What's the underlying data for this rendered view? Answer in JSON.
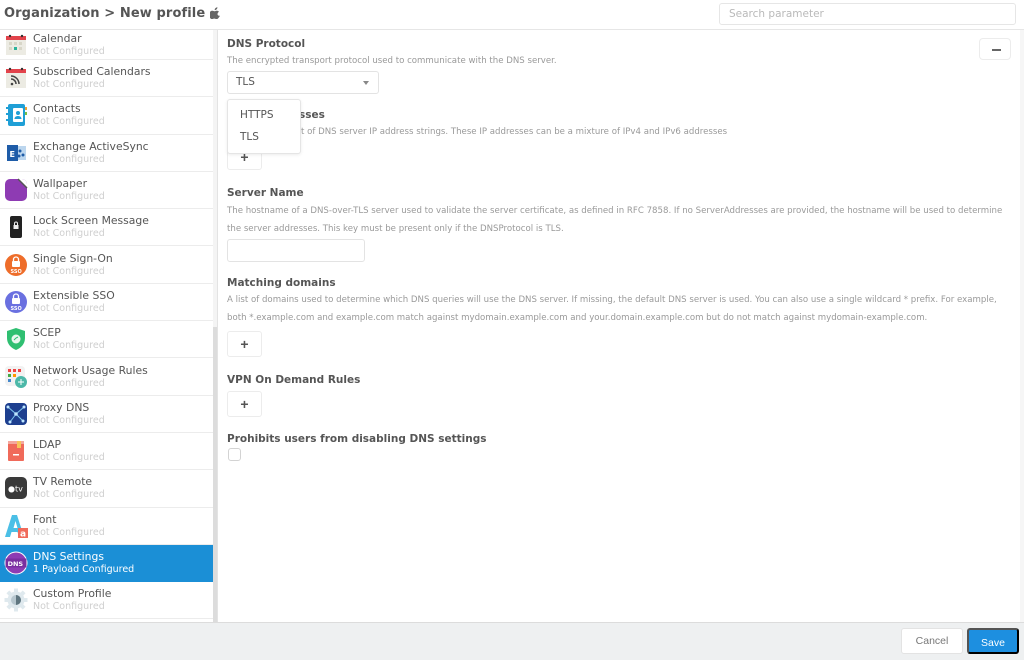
{
  "header": {
    "breadcrumb": "Organization > New profile",
    "platform_icon": "apple-icon",
    "search_placeholder": "Search parameter"
  },
  "sidebar": {
    "items": [
      {
        "label": "Calendar",
        "status": "Not Configured",
        "icon": "calendar-icon"
      },
      {
        "label": "Subscribed Calendars",
        "status": "Not Configured",
        "icon": "subscribed-calendar-icon"
      },
      {
        "label": "Contacts",
        "status": "Not Configured",
        "icon": "contacts-icon"
      },
      {
        "label": "Exchange ActiveSync",
        "status": "Not Configured",
        "icon": "exchange-icon"
      },
      {
        "label": "Wallpaper",
        "status": "Not Configured",
        "icon": "wallpaper-icon"
      },
      {
        "label": "Lock Screen Message",
        "status": "Not Configured",
        "icon": "lock-screen-icon"
      },
      {
        "label": "Single Sign-On",
        "status": "Not Configured",
        "icon": "sso-icon"
      },
      {
        "label": "Extensible SSO",
        "status": "Not Configured",
        "icon": "extensible-sso-icon"
      },
      {
        "label": "SCEP",
        "status": "Not Configured",
        "icon": "scep-shield-icon"
      },
      {
        "label": "Network Usage Rules",
        "status": "Not Configured",
        "icon": "network-usage-icon"
      },
      {
        "label": "Proxy DNS",
        "status": "Not Configured",
        "icon": "proxy-dns-icon"
      },
      {
        "label": "LDAP",
        "status": "Not Configured",
        "icon": "ldap-icon"
      },
      {
        "label": "TV Remote",
        "status": "Not Configured",
        "icon": "apple-tv-icon"
      },
      {
        "label": "Font",
        "status": "Not Configured",
        "icon": "font-icon"
      },
      {
        "label": "DNS Settings",
        "status": "1 Payload Configured",
        "icon": "dns-icon",
        "active": true
      },
      {
        "label": "Custom Profile",
        "status": "Not Configured",
        "icon": "gear-icon"
      }
    ]
  },
  "main": {
    "dns_protocol": {
      "title": "DNS Protocol",
      "description": "The encrypted transport protocol used to communicate with the DNS server.",
      "selected": "TLS",
      "options": [
        "HTTPS",
        "TLS"
      ]
    },
    "server_addresses": {
      "title_visible": "sses",
      "description_visible": "t of DNS server IP address strings. These IP addresses can be a mixture of IPv4 and IPv6 addresses",
      "add_label": "+"
    },
    "server_name": {
      "title": "Server Name",
      "description": "The hostname of a DNS-over-TLS server used to validate the server certificate, as defined in RFC 7858. If no ServerAddresses are provided, the hostname will be used to determine the server addresses. This key must be present only if the DNSProtocol is TLS.",
      "value": ""
    },
    "matching_domains": {
      "title": "Matching domains",
      "description": "A list of domains used to determine which DNS queries will use the DNS server. If missing, the default DNS server is used. You can also use a single wildcard * prefix. For example, both *.example.com and example.com match against mydomain.example.com and your.domain.example.com but do not match against mydomain-example.com.",
      "add_label": "+"
    },
    "vpn_on_demand": {
      "title": "VPN On Demand Rules",
      "add_label": "+"
    },
    "prohibit_disable": {
      "title": "Prohibits users from disabling DNS settings",
      "checked": false
    },
    "collapse_label": "−"
  },
  "footer": {
    "cancel_label": "Cancel",
    "save_label": "Save"
  },
  "colors": {
    "accent": "#1b8fd6",
    "save_button": "#1d8fe0"
  }
}
